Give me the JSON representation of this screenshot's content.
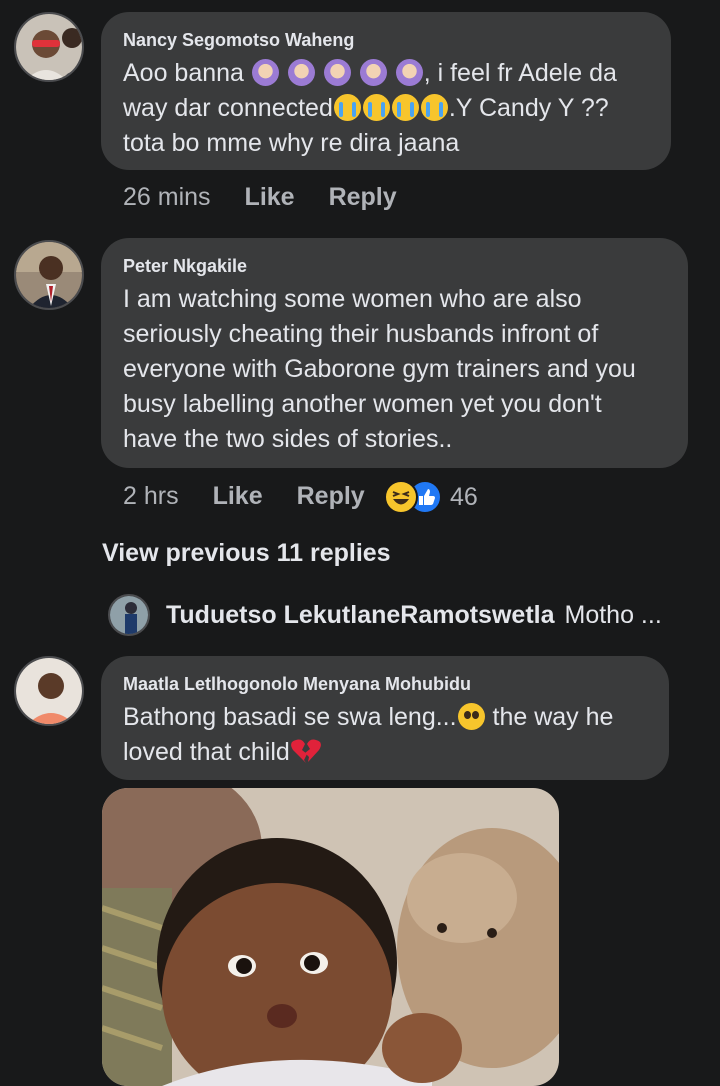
{
  "comments": [
    {
      "author": "Nancy Segomotso Waheng",
      "line1_a": "Aoo banna ",
      "line1_b": ", i feel fr Adele da",
      "line2_a": "way dar connected",
      "line2_b": ".Y Candy Y ??",
      "line3": "tota bo mme why re dira jaana",
      "time": "26 mins",
      "like": "Like",
      "reply": "Reply"
    },
    {
      "author": "Peter Nkgakile",
      "lines": [
        "I am watching some women who are also",
        "seriously cheating their husbands infront of",
        "everyone with Gaborone gym trainers and you",
        "busy labelling another women yet you don't",
        "have the two sides of stories.."
      ],
      "time": "2 hrs",
      "like": "Like",
      "reply": "Reply",
      "reaction_count": "46"
    }
  ],
  "view_previous": "View previous 11 replies",
  "collapsed_reply": {
    "author": "Tuduetso LekutlaneRamotswetla",
    "snippet": "Motho ..."
  },
  "reply_comment": {
    "author": "Maatla Letlhogonolo Menyana Mohubidu",
    "line1_a": "Bathong basadi se swa leng...",
    "line1_b": " the way he",
    "line2": "loved that child"
  },
  "icons": {
    "purple_emoji": "woman-gesturing-emoji-icon",
    "cry_emoji": "loudly-crying-face-icon",
    "pleading_emoji": "pleading-face-icon",
    "heart": "broken-heart-icon",
    "haha": "haha-reaction-icon",
    "like": "like-reaction-icon"
  },
  "colors": {
    "background": "#18191a",
    "bubble": "#3a3b3c",
    "text": "#e4e6eb",
    "muted": "#b0b3b8",
    "like_blue": "#2078f4"
  }
}
